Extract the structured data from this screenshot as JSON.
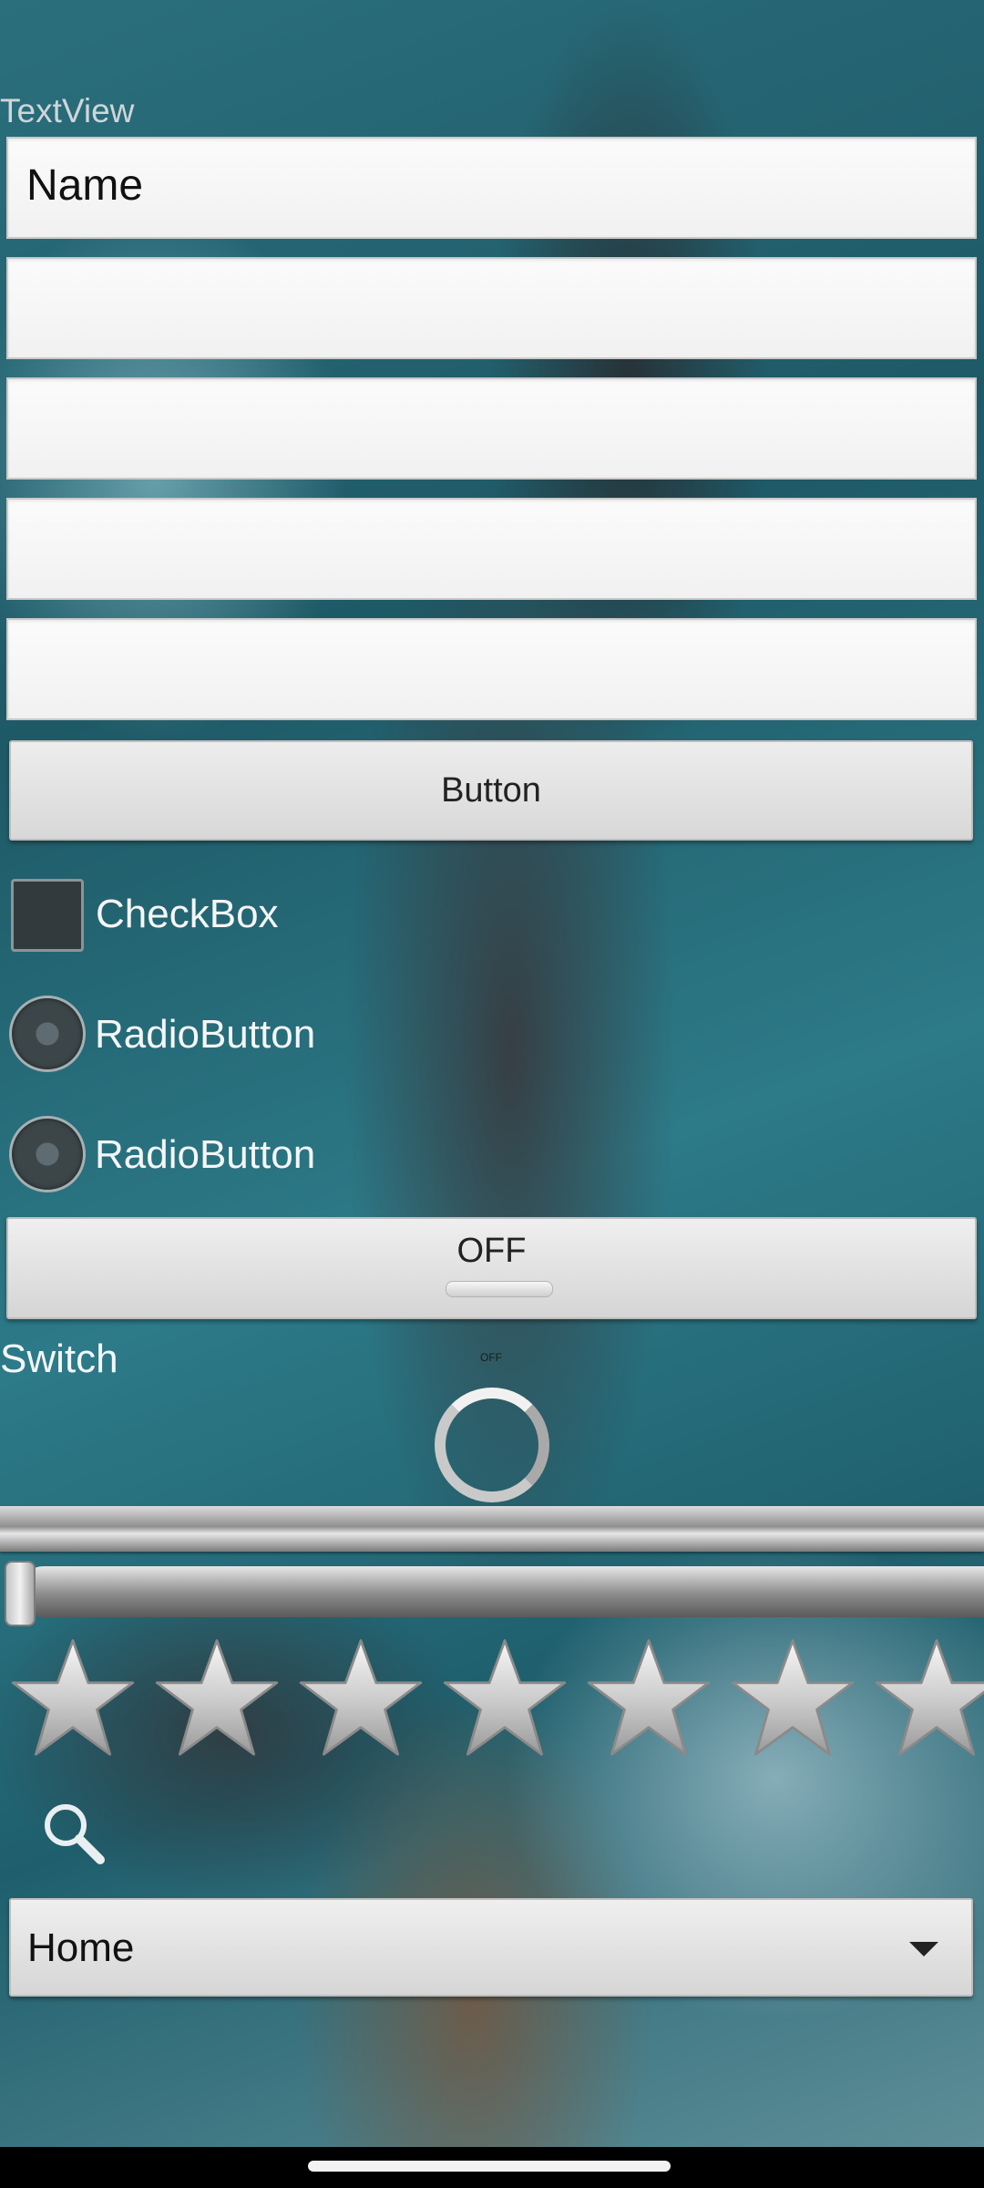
{
  "textview": {
    "label": "TextView"
  },
  "fields": [
    {
      "value": "Name"
    },
    {
      "value": ""
    },
    {
      "value": ""
    },
    {
      "value": ""
    },
    {
      "value": ""
    }
  ],
  "button": {
    "label": "Button"
  },
  "checkbox": {
    "label": "CheckBox",
    "checked": false
  },
  "radios": [
    {
      "label": "RadioButton",
      "checked": false
    },
    {
      "label": "RadioButton",
      "checked": false
    }
  ],
  "toggle_button": {
    "label": "OFF"
  },
  "switch": {
    "label": "Switch",
    "state_text": "OFF"
  },
  "seekbar": {
    "value": 0
  },
  "rating": {
    "stars_visible": 7,
    "rating": 0
  },
  "icons": {
    "search": "search-icon",
    "dropdown": "chevron-down-icon",
    "star": "star-icon"
  },
  "dropdown": {
    "selected": "Home"
  }
}
